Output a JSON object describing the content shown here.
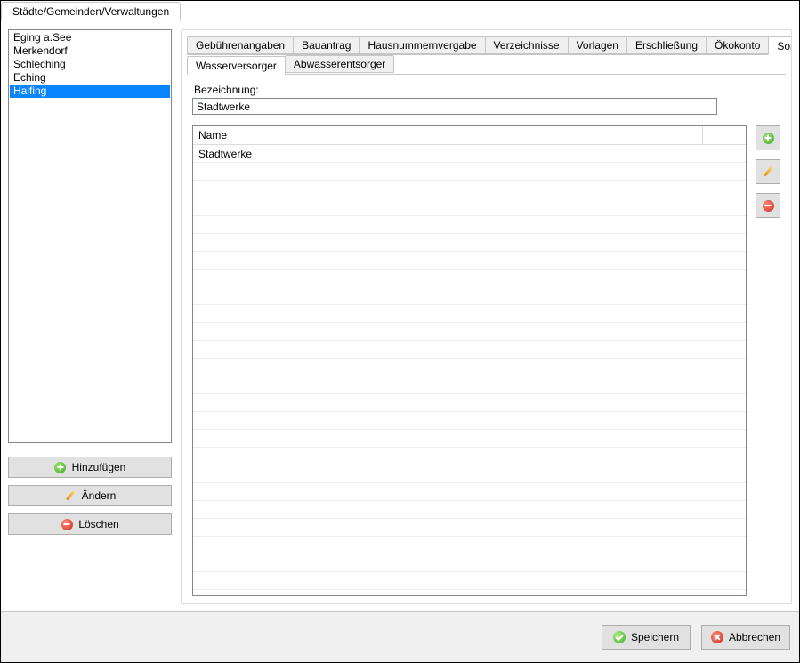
{
  "top_tab": {
    "label": "Städte/Gemeinden/Verwaltungen"
  },
  "city_list": {
    "items": [
      "Eging a.See",
      "Merkendorf",
      "Schleching",
      "Eching",
      "Halfing"
    ],
    "selected_index": 4
  },
  "left_buttons": {
    "add": "Hinzufügen",
    "edit": "Ändern",
    "delete": "Löschen"
  },
  "main_tabs": {
    "items": [
      "Gebührenangaben",
      "Bauantrag",
      "Hausnummernvergabe",
      "Verzeichnisse",
      "Vorlagen",
      "Erschließung",
      "Ökokonto",
      "Sonstiges"
    ],
    "active_index": 7
  },
  "sub_tabs": {
    "items": [
      "Wasserversorger",
      "Abwasserentsorger"
    ],
    "active_index": 0
  },
  "form": {
    "bezeichnung_label": "Bezeichnung:",
    "bezeichnung_value": "Stadtwerke"
  },
  "grid": {
    "columns": [
      "Name",
      ""
    ],
    "rows": [
      "Stadtwerke"
    ]
  },
  "footer": {
    "save": "Speichern",
    "cancel": "Abbrechen"
  }
}
